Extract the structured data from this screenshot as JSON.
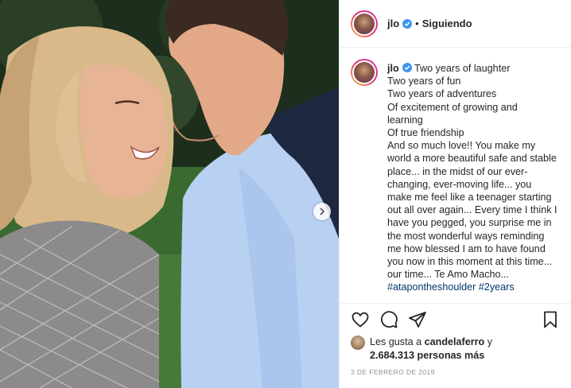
{
  "post": {
    "username": "jlo",
    "follow_separator": "•",
    "follow_status": "Siguiendo",
    "caption_lines": [
      "Two years of laughter",
      "Two years of fun",
      "Two years of adventures",
      "Of excitement of growing and",
      "learning",
      "Of true friendship",
      "And so much love!! You make my",
      "world a more beautiful safe and stable",
      "place... in the midst of our ever-",
      "changing, ever-moving life... you",
      "make me feel like a teenager starting",
      "out all over again... Every time I think I",
      "have you pegged, you surprise me in",
      "the most wonderful ways reminding",
      "me how blessed I am to have found",
      "you now in this moment at this time...",
      "our time... Te Amo Macho..."
    ],
    "hashtags": [
      "#ataponthes houlder",
      "#2years"
    ],
    "likes": {
      "prefix": "Les gusta a",
      "user": "candelaferro",
      "conjunction": "y",
      "count": "2.684.313 personas más"
    },
    "date": "3 de febrero de 2019"
  },
  "icons": {
    "like": "heart-outline-icon",
    "comment": "comment-bubble-icon",
    "share": "paper-plane-icon",
    "save": "bookmark-icon",
    "verified": "verified-badge-icon",
    "carousel_next": "chevron-right-icon"
  },
  "colors": {
    "verified": "#3897f0",
    "hashtag": "#00376b",
    "muted": "#8e8e8e"
  }
}
